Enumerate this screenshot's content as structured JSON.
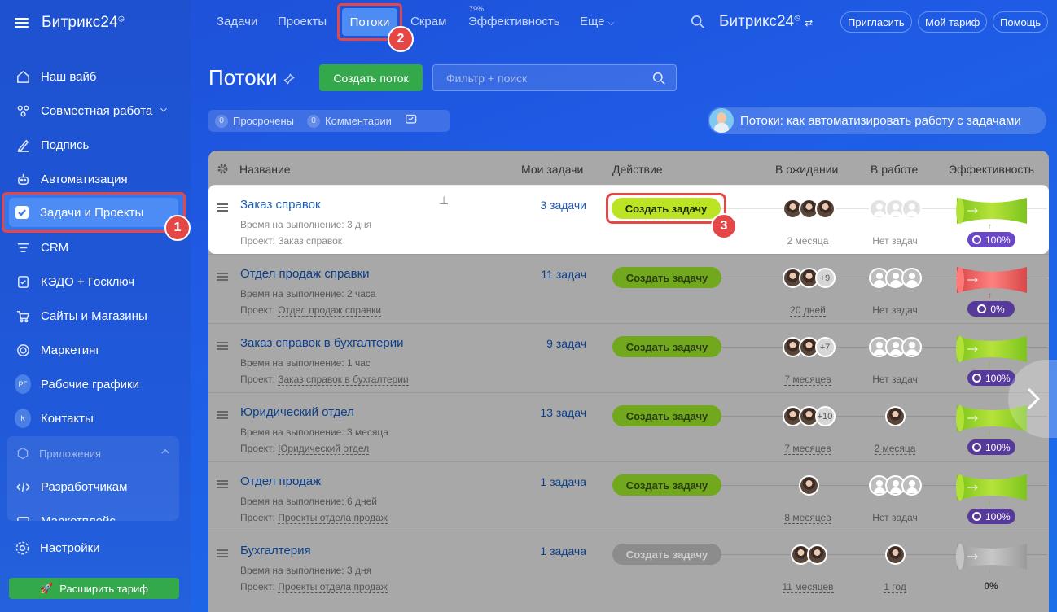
{
  "brand": "Битрикс24",
  "sidebar": {
    "items": [
      {
        "label": "Наш вайб",
        "icon": "home-icon"
      },
      {
        "label": "Совместная работа",
        "icon": "collab-icon"
      },
      {
        "label": "Подпись",
        "icon": "signature-icon"
      },
      {
        "label": "Автоматизация",
        "icon": "robot-icon"
      },
      {
        "label": "Задачи и Проекты",
        "icon": "tasks-checkbox-icon"
      },
      {
        "label": "CRM",
        "icon": "crm-icon"
      },
      {
        "label": "КЭДО + Госключ",
        "icon": "document-icon"
      },
      {
        "label": "Сайты и Магазины",
        "icon": "cart-icon"
      },
      {
        "label": "Маркетинг",
        "icon": "target-icon"
      },
      {
        "label": "Рабочие графики",
        "icon": "rg-avatar"
      },
      {
        "label": "Контакты",
        "icon": "k-avatar"
      }
    ],
    "apps_title": "Приложения",
    "apps_items": [
      {
        "label": "Разработчикам"
      },
      {
        "label": "Маркетплейс"
      }
    ],
    "rg_initials": "РГ",
    "k_initial": "К",
    "settings": "Настройки",
    "upgrade": "Расширить тариф"
  },
  "topnav": {
    "tasks": "Задачи",
    "projects": "Проекты",
    "flows": "Потоки",
    "scrum": "Скрам",
    "efficiency_pct": "79%",
    "efficiency": "Эффективность",
    "more": "Еще",
    "invite": "Пригласить",
    "tariff": "Мой тариф",
    "help": "Помощь"
  },
  "page": {
    "title": "Потоки",
    "create_flow": "Создать поток",
    "filter_placeholder": "Фильтр + поиск",
    "overdue_count": "0",
    "overdue": "Просрочены",
    "comments_count": "0",
    "comments": "Комментарии",
    "promo": "Потоки: как автоматизировать работу с задачами"
  },
  "table": {
    "headers": {
      "name": "Название",
      "my_tasks": "Мои задачи",
      "action": "Действие",
      "pending": "В ожидании",
      "in_work": "В работе",
      "efficiency": "Эффективность"
    },
    "time_label": "Время на выполнение:",
    "project_label": "Проект:",
    "rows": [
      {
        "name": "Заказ справок",
        "time": "3 дня",
        "project": "Заказ справок",
        "my": "3 задачи",
        "action": "Создать задачу",
        "pending_more": "",
        "pending_sub": "2 месяца",
        "work_sub": "Нет задач",
        "eff": "100%",
        "eff_color": "green"
      },
      {
        "name": "Отдел продаж справки",
        "time": "2 часа",
        "project": "Отдел продаж справки",
        "my": "11 задач",
        "action": "Создать задачу",
        "pending_more": "+9",
        "pending_sub": "20 дней",
        "work_sub": "Нет задач",
        "eff": "0%",
        "eff_color": "red"
      },
      {
        "name": "Заказ справок в бухгалтерии",
        "time": "1 час",
        "project": "Заказ справок в бухгалтерии",
        "my": "9 задач",
        "action": "Создать задачу",
        "pending_more": "+7",
        "pending_sub": "7 месяцев",
        "work_sub": "Нет задач",
        "eff": "100%",
        "eff_color": "green"
      },
      {
        "name": "Юридический отдел",
        "time": "3 месяца",
        "project": "Юридический отдел",
        "my": "13 задач",
        "action": "Создать задачу",
        "pending_more": "+10",
        "pending_sub": "7 месяцев",
        "work_sub": "2 месяца",
        "eff": "100%",
        "eff_color": "green"
      },
      {
        "name": "Отдел продаж",
        "time": "6 дней",
        "project": "Проекты отдела продаж",
        "my": "1 задача",
        "action": "Создать задачу",
        "pending_more": "",
        "pending_sub": "8 месяцев",
        "work_sub": "Нет задач",
        "eff": "100%",
        "eff_color": "green"
      },
      {
        "name": "Бухгалтерия",
        "time": "3 дня",
        "project": "Проекты отдела продаж",
        "my": "1 задача",
        "action": "Создать задачу",
        "pending_more": "",
        "pending_sub": "11 месяцев",
        "work_sub": "1 год",
        "eff": "0%",
        "eff_color": "gray"
      }
    ]
  },
  "annotations": [
    "1",
    "2",
    "3"
  ],
  "colors": {
    "accent_blue": "#1f58d9",
    "green": "#34a94c",
    "highlight_red": "#e54747",
    "lime": "#bde325",
    "purple": "#6a46c8"
  }
}
